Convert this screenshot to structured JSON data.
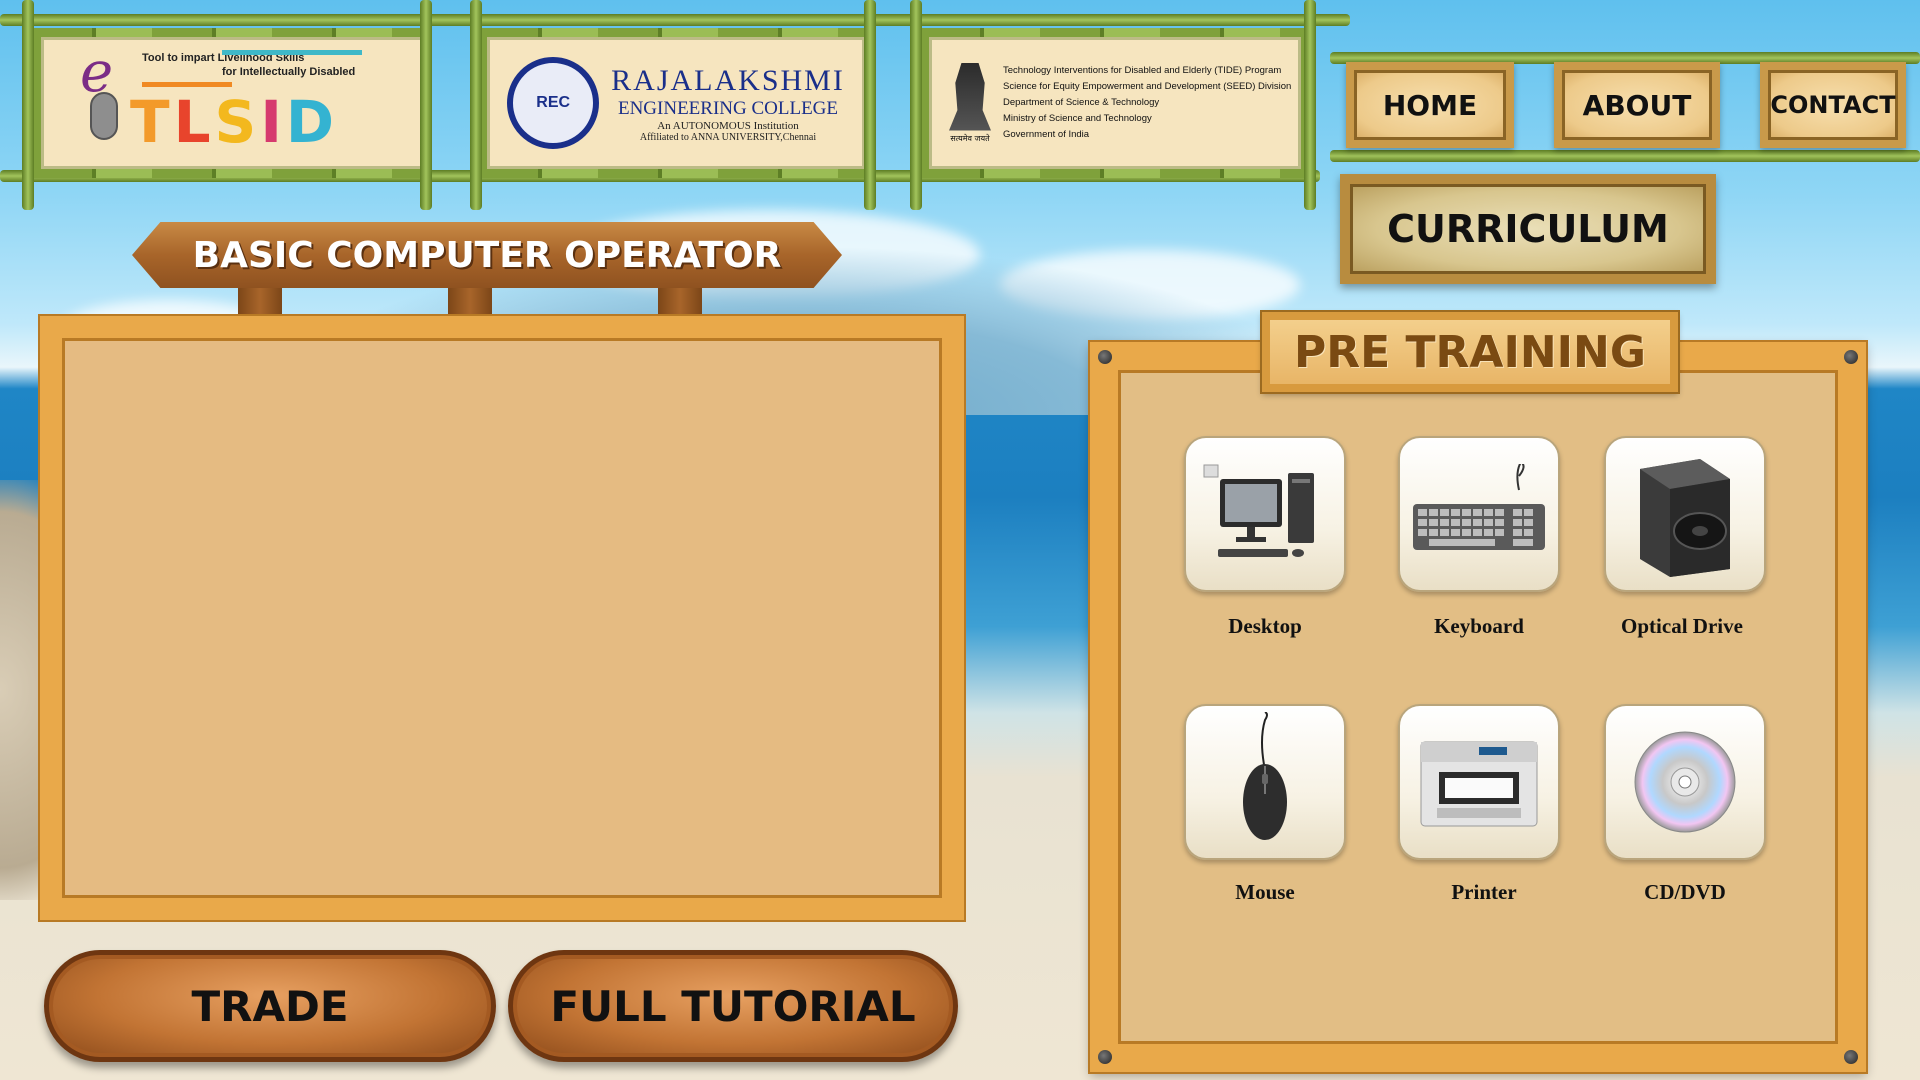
{
  "header": {
    "tlsid_logo": {
      "tagline_line1": "Tool to impart Livelihood Skills",
      "tagline_line2": "for Intellectually Disabled",
      "e_letter": "e",
      "wordmark": "TLSID"
    },
    "rec_logo": {
      "name_line1": "RAJALAKSHMI",
      "name_line2": "ENGINEERING COLLEGE",
      "name_line3": "An AUTONOMOUS Institution",
      "name_line4": "Affiliated to ANNA UNIVERSITY,Chennai",
      "emblem_text": "REC"
    },
    "gov_logo": {
      "lines": [
        "Technology Interventions for Disabled and Elderly (TIDE) Program",
        "Science for Equity Empowerment and Development (SEED) Division",
        "Department of Science & Technology",
        "Ministry of Science and Technology",
        "Government of India"
      ],
      "motto": "सत्यमेव जयते"
    }
  },
  "nav": {
    "home": "HOME",
    "about": "ABOUT",
    "contact": "CONTACT",
    "curriculum": "CURRICULUM"
  },
  "course_sign": "BASIC COMPUTER OPERATOR",
  "buttons": {
    "trade": "TRADE",
    "full_tutorial": "FULL TUTORIAL"
  },
  "pre_training": {
    "title": "PRE TRAINING",
    "items": [
      {
        "label": "Desktop",
        "icon": "desktop-computer-icon"
      },
      {
        "label": "Keyboard",
        "icon": "keyboard-icon"
      },
      {
        "label": "Optical Drive",
        "icon": "optical-drive-icon"
      },
      {
        "label": "Mouse",
        "icon": "mouse-icon"
      },
      {
        "label": "Printer",
        "icon": "printer-icon"
      },
      {
        "label": "CD/DVD",
        "icon": "cd-dvd-icon"
      }
    ]
  },
  "colors": {
    "bamboo_green": "#8fb04a",
    "wood_frame": "#e9a94a",
    "board_fill": "#e5bb82",
    "sky_blue": "#5fc0ee",
    "sea_blue": "#1f86c6"
  }
}
